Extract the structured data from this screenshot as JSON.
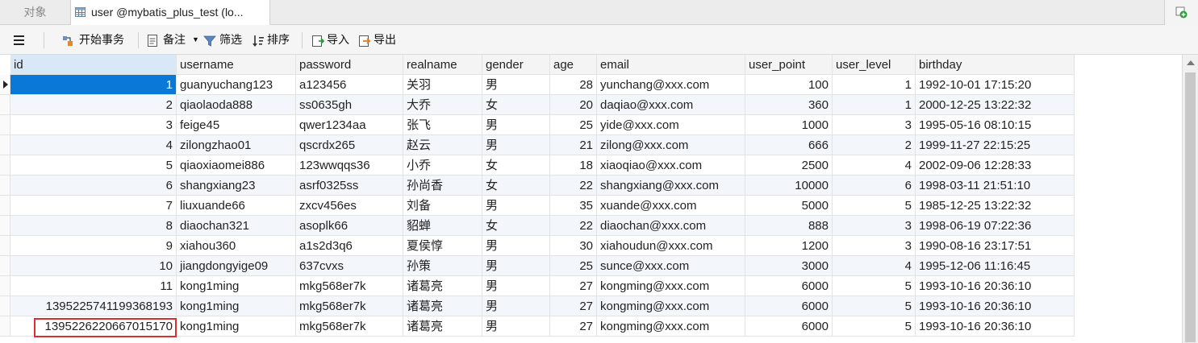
{
  "tabs": {
    "objects_label": "对象",
    "active_label": "user @mybatis_plus_test (lo..."
  },
  "toolbar": {
    "begin_transaction": "开始事务",
    "memo": "备注",
    "filter": "筛选",
    "sort": "排序",
    "import": "导入",
    "export": "导出"
  },
  "grid": {
    "columns": [
      "id",
      "username",
      "password",
      "realname",
      "gender",
      "age",
      "email",
      "user_point",
      "user_level",
      "birthday"
    ],
    "rows": [
      [
        "1",
        "guanyuchang123",
        "a123456",
        "关羽",
        "男",
        "28",
        "yunchang@xxx.com",
        "100",
        "1",
        "1992-10-01 17:15:20"
      ],
      [
        "2",
        "qiaolaoda888",
        "ss0635gh",
        "大乔",
        "女",
        "20",
        "daqiao@xxx.com",
        "360",
        "1",
        "2000-12-25 13:22:32"
      ],
      [
        "3",
        "feige45",
        "qwer1234aa",
        "张飞",
        "男",
        "25",
        "yide@xxx.com",
        "1000",
        "3",
        "1995-05-16 08:10:15"
      ],
      [
        "4",
        "zilongzhao01",
        "qscrdx265",
        "赵云",
        "男",
        "21",
        "zilong@xxx.com",
        "666",
        "2",
        "1999-11-27 22:15:25"
      ],
      [
        "5",
        "qiaoxiaomei886",
        "123wwqqs36",
        "小乔",
        "女",
        "18",
        "xiaoqiao@xxx.com",
        "2500",
        "4",
        "2002-09-06 12:28:33"
      ],
      [
        "6",
        "shangxiang23",
        "asrf0325ss",
        "孙尚香",
        "女",
        "22",
        "shangxiang@xxx.com",
        "10000",
        "6",
        "1998-03-11 21:51:10"
      ],
      [
        "7",
        "liuxuande66",
        "zxcv456es",
        "刘备",
        "男",
        "35",
        "xuande@xxx.com",
        "5000",
        "5",
        "1985-12-25 13:22:32"
      ],
      [
        "8",
        "diaochan321",
        "asoplk66",
        "貂蝉",
        "女",
        "22",
        "diaochan@xxx.com",
        "888",
        "3",
        "1998-06-19 07:22:36"
      ],
      [
        "9",
        "xiahou360",
        "a1s2d3q6",
        "夏侯惇",
        "男",
        "30",
        "xiahoudun@xxx.com",
        "1200",
        "3",
        "1990-08-16 23:17:51"
      ],
      [
        "10",
        "jiangdongyige09",
        "637cvxs",
        "孙策",
        "男",
        "25",
        "sunce@xxx.com",
        "3000",
        "4",
        "1995-12-06 11:16:45"
      ],
      [
        "11",
        "kong1ming",
        "mkg568er7k",
        "诸葛亮",
        "男",
        "27",
        "kongming@xxx.com",
        "6000",
        "5",
        "1993-10-16 20:36:10"
      ],
      [
        "1395225741199368193",
        "kong1ming",
        "mkg568er7k",
        "诸葛亮",
        "男",
        "27",
        "kongming@xxx.com",
        "6000",
        "5",
        "1993-10-16 20:36:10"
      ],
      [
        "1395226220667015170",
        "kong1ming",
        "mkg568er7k",
        "诸葛亮",
        "男",
        "27",
        "kongming@xxx.com",
        "6000",
        "5",
        "1993-10-16 20:36:10"
      ]
    ]
  }
}
